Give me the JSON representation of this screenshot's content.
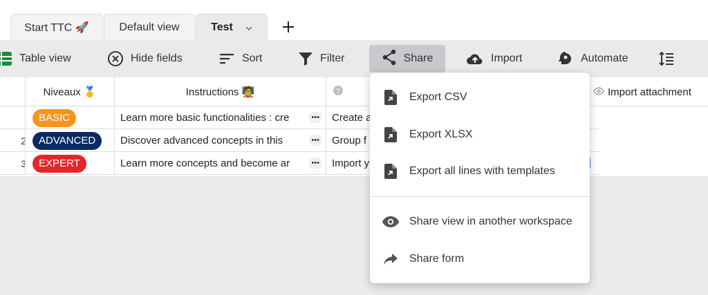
{
  "tabs": [
    {
      "label": "Start TTC 🚀"
    },
    {
      "label": "Default view"
    },
    {
      "label": "Test"
    }
  ],
  "add_tab_label": "+",
  "toolbar": {
    "table_view": "Table view",
    "hide_fields": "Hide fields",
    "sort": "Sort",
    "filter": "Filter",
    "share": "Share",
    "import": "Import",
    "automate": "Automate"
  },
  "table": {
    "headers": {
      "niveaux": "Niveaux 🥇",
      "instructions": "Instructions 🧑‍🏫",
      "import_attachment": "Import attachment"
    },
    "rows": [
      {
        "num": "",
        "level": "BASIC",
        "level_color": "#f7941d",
        "instructions": "Learn more basic functionalities : cre",
        "third": "Create a"
      },
      {
        "num": "2",
        "level": "ADVANCED",
        "level_color": "#0b2a63",
        "instructions": "Discover advanced concepts in this",
        "third": "Group f"
      },
      {
        "num": "3",
        "level": "EXPERT",
        "level_color": "#e3262a",
        "instructions": "Learn more concepts and become ar",
        "third": "Import y"
      }
    ]
  },
  "share_menu": {
    "items": [
      {
        "label": "Export CSV"
      },
      {
        "label": "Export XLSX"
      },
      {
        "label": "Export all lines with templates"
      },
      {
        "label": "Share view in another workspace"
      },
      {
        "label": "Share form"
      }
    ]
  }
}
